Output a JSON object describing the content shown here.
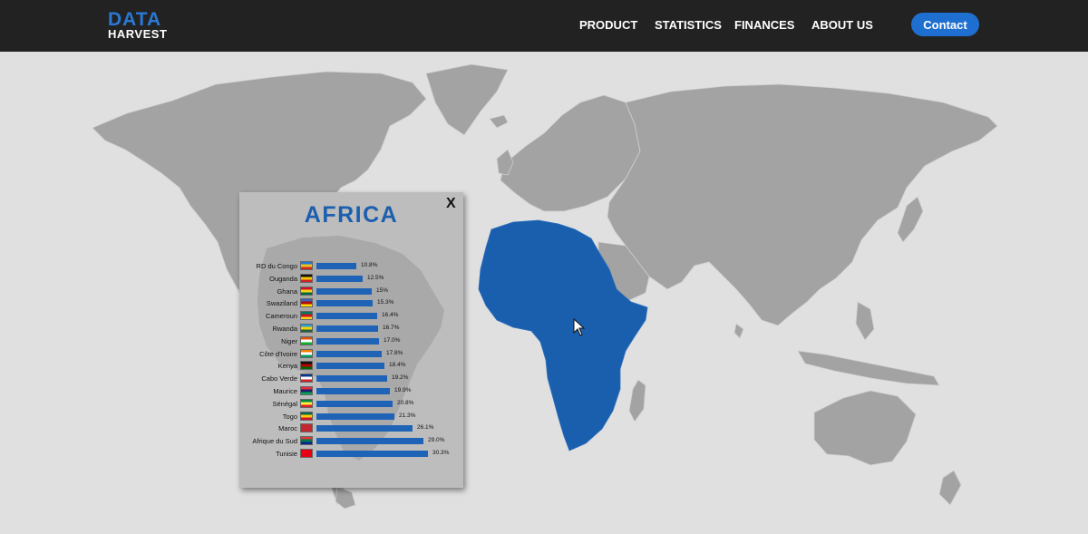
{
  "brand": {
    "line1": "DATA",
    "line2": "HARVEST"
  },
  "nav": {
    "items": [
      "PRODUCT",
      "STATISTICS",
      "FINANCES",
      "ABOUT US"
    ],
    "contact_label": "Contact"
  },
  "colors": {
    "header_bg": "#222222",
    "accent": "#1f6fd0",
    "land": "#a3a3a3",
    "highlight": "#1a5fad",
    "background": "#e0e0e0"
  },
  "map": {
    "selected_region": "Africa"
  },
  "popup": {
    "title": "AFRICA",
    "close_label": "X",
    "rows": [
      {
        "country": "RD du Congo",
        "value": "10.8%",
        "num": 10.8,
        "flag": [
          "#1f7ad8",
          "#e8c31a",
          "#d02424"
        ]
      },
      {
        "country": "Ouganda",
        "value": "12.5%",
        "num": 12.5,
        "flag": [
          "#111111",
          "#f2c600",
          "#d21f26"
        ]
      },
      {
        "country": "Ghana",
        "value": "15%",
        "num": 15.0,
        "flag": [
          "#ce1126",
          "#fcd116",
          "#006b3f"
        ]
      },
      {
        "country": "Swaziland",
        "value": "15.3%",
        "num": 15.3,
        "flag": [
          "#3e5eb9",
          "#b10c0c",
          "#ffd900"
        ]
      },
      {
        "country": "Cameroun",
        "value": "16.4%",
        "num": 16.4,
        "flag": [
          "#007a5e",
          "#ce1126",
          "#fcd116"
        ]
      },
      {
        "country": "Rwanda",
        "value": "16.7%",
        "num": 16.7,
        "flag": [
          "#20a0d8",
          "#fad201",
          "#20603d"
        ]
      },
      {
        "country": "Niger",
        "value": "17.0%",
        "num": 17.0,
        "flag": [
          "#e05206",
          "#ffffff",
          "#0db02b"
        ]
      },
      {
        "country": "Côte d'Ivoire",
        "value": "17.8%",
        "num": 17.8,
        "flag": [
          "#f77f00",
          "#ffffff",
          "#009e60"
        ]
      },
      {
        "country": "Kenya",
        "value": "18.4%",
        "num": 18.4,
        "flag": [
          "#111111",
          "#bb0000",
          "#006600"
        ]
      },
      {
        "country": "Cabo Verde",
        "value": "19.2%",
        "num": 19.2,
        "flag": [
          "#003893",
          "#ffffff",
          "#cf2027"
        ]
      },
      {
        "country": "Maurice",
        "value": "19.9%",
        "num": 19.9,
        "flag": [
          "#ea2839",
          "#1a206d",
          "#00a551"
        ]
      },
      {
        "country": "Sénégal",
        "value": "20.8%",
        "num": 20.8,
        "flag": [
          "#00853f",
          "#fdef42",
          "#e31b23"
        ]
      },
      {
        "country": "Togo",
        "value": "21.3%",
        "num": 21.3,
        "flag": [
          "#006a4e",
          "#ffce00",
          "#d21034"
        ]
      },
      {
        "country": "Maroc",
        "value": "26.1%",
        "num": 26.1,
        "flag": [
          "#c1272d",
          "#c1272d",
          "#c1272d"
        ]
      },
      {
        "country": "Afrique du Sud",
        "value": "29.0%",
        "num": 29.0,
        "flag": [
          "#de3831",
          "#007a4d",
          "#002395"
        ]
      },
      {
        "country": "Tunisie",
        "value": "30.3%",
        "num": 30.3,
        "flag": [
          "#e70013",
          "#e70013",
          "#e70013"
        ]
      }
    ]
  }
}
